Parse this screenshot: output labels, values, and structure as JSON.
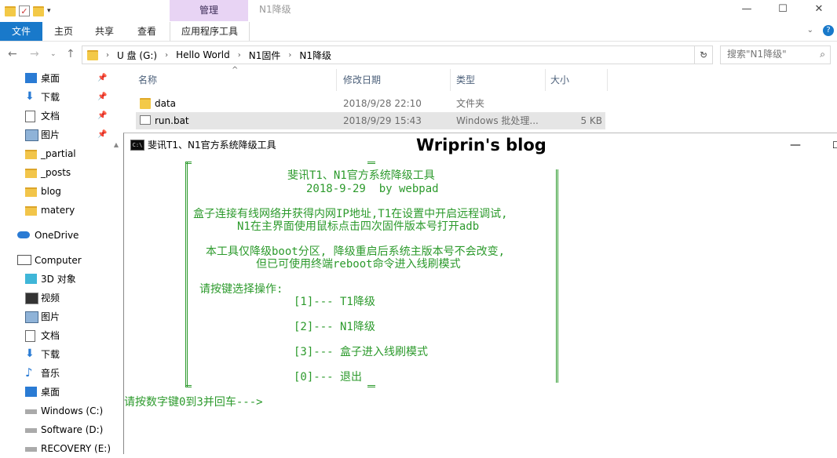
{
  "titlebar": {
    "context_tab": "管理",
    "title": "N1降级",
    "controls": {
      "minimize": "—",
      "maximize": "☐",
      "close": "✕"
    }
  },
  "ribbon": {
    "tabs": [
      "文件",
      "主页",
      "共享",
      "查看",
      "应用程序工具"
    ],
    "help": "?"
  },
  "address": {
    "path": [
      "U 盘 (G:)",
      "Hello World",
      "N1固件",
      "N1降级"
    ],
    "search_placeholder": "搜索\"N1降级\""
  },
  "sidebar": {
    "quick_access": [
      {
        "label": "桌面",
        "icon": "desktop-icon",
        "pinned": true
      },
      {
        "label": "下载",
        "icon": "download-icon",
        "pinned": true
      },
      {
        "label": "文档",
        "icon": "document-icon",
        "pinned": true
      },
      {
        "label": "图片",
        "icon": "picture-icon",
        "pinned": true
      },
      {
        "label": "_partial",
        "icon": "folder-icon",
        "pinned": false
      },
      {
        "label": "_posts",
        "icon": "folder-icon",
        "pinned": false
      },
      {
        "label": "blog",
        "icon": "folder-icon",
        "pinned": false
      },
      {
        "label": "matery",
        "icon": "folder-icon",
        "pinned": false
      }
    ],
    "onedrive": "OneDrive",
    "computer": "Computer",
    "computer_items": [
      {
        "label": "3D 对象",
        "icon": "3d-objects-icon"
      },
      {
        "label": "视频",
        "icon": "video-icon"
      },
      {
        "label": "图片",
        "icon": "picture-icon"
      },
      {
        "label": "文档",
        "icon": "document-icon"
      },
      {
        "label": "下载",
        "icon": "download-icon"
      },
      {
        "label": "音乐",
        "icon": "music-icon"
      },
      {
        "label": "桌面",
        "icon": "desktop-icon"
      },
      {
        "label": "Windows (C:)",
        "icon": "drive-icon"
      },
      {
        "label": "Software (D:)",
        "icon": "drive-icon"
      },
      {
        "label": "RECOVERY (E:)",
        "icon": "drive-icon"
      }
    ]
  },
  "filelist": {
    "columns": [
      "名称",
      "修改日期",
      "类型",
      "大小"
    ],
    "rows": [
      {
        "name": "data",
        "date": "2018/9/28 22:10",
        "type": "文件夹",
        "size": ""
      },
      {
        "name": "run.bat",
        "date": "2018/9/29 15:43",
        "type": "Windows 批处理...",
        "size": "5 KB"
      }
    ]
  },
  "console": {
    "title": "斐讯T1、N1官方系统降级工具",
    "watermark": "Wriprin's blog",
    "lines": [
      "斐讯T1、N1官方系统降级工具",
      "2018-9-29  by webpad",
      "盒子连接有线网络并获得内网IP地址,T1在设置中开启远程调试,",
      "N1在主界面使用鼠标点击四次固件版本号打开adb",
      "本工具仅降级boot分区, 降级重启后系统主版本号不会改变,",
      "但已可使用终端reboot命令进入线刷模式",
      "请按键选择操作:",
      "[1]--- T1降级",
      "[2]--- N1降级",
      "[3]--- 盒子进入线刷模式",
      "[0]--- 退出"
    ],
    "prompt": "请按数字键0到3并回车--->"
  },
  "colors": {
    "accent": "#1979ca",
    "context_tab": "#e8d4f4",
    "console_text": "#2c9a2c"
  }
}
